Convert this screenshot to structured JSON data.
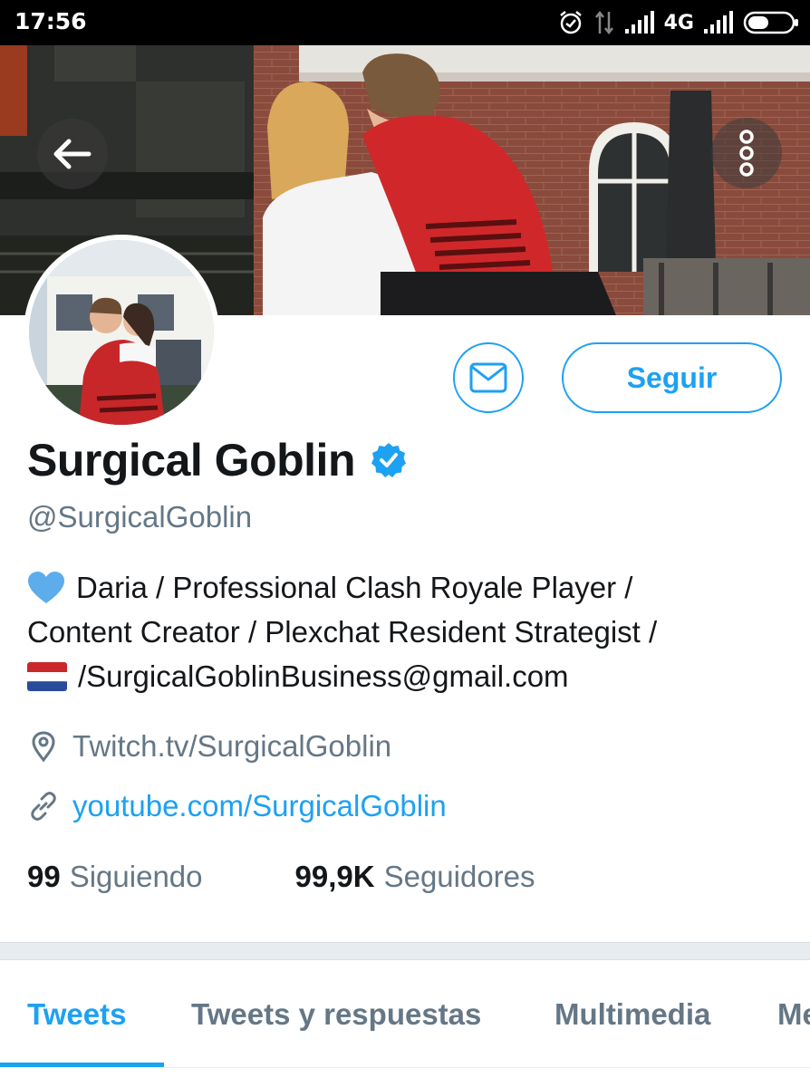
{
  "status_bar": {
    "time": "17:56",
    "network": "4G",
    "icons": [
      "alarm-icon",
      "data-transfer-icon",
      "signal-icon",
      "signal-icon",
      "battery-icon"
    ]
  },
  "header": {
    "back_icon": "arrow-left-icon",
    "more_icon": "more-vertical-icon"
  },
  "actions": {
    "message_icon": "envelope-icon",
    "follow_label": "Seguir"
  },
  "profile": {
    "name": "Surgical Goblin",
    "verified_icon": "verified-badge-icon",
    "handle": "@SurgicalGoblin",
    "bio": {
      "line1": "Daria / Professional Clash Royale Player /",
      "line2": "Content Creator / Plexchat Resident Strategist /",
      "line3": "/SurgicalGoblinBusiness@gmail.com",
      "emoji_heart": "blue-heart-icon",
      "emoji_flag": "netherlands-flag-icon"
    },
    "location": "Twitch.tv/SurgicalGoblin",
    "url": "youtube.com/SurgicalGoblin",
    "following_count": "99",
    "following_label": "Siguiendo",
    "followers_count": "99,9K",
    "followers_label": "Seguidores"
  },
  "tabs": [
    {
      "label": "Tweets",
      "active": true
    },
    {
      "label": "Tweets y respuestas",
      "active": false
    },
    {
      "label": "Multimedia",
      "active": false
    },
    {
      "label": "Me",
      "active": false
    }
  ],
  "colors": {
    "accent": "#1da1f2",
    "text_primary": "#14171a",
    "text_secondary": "#657786",
    "divider": "#e6ecf0"
  }
}
